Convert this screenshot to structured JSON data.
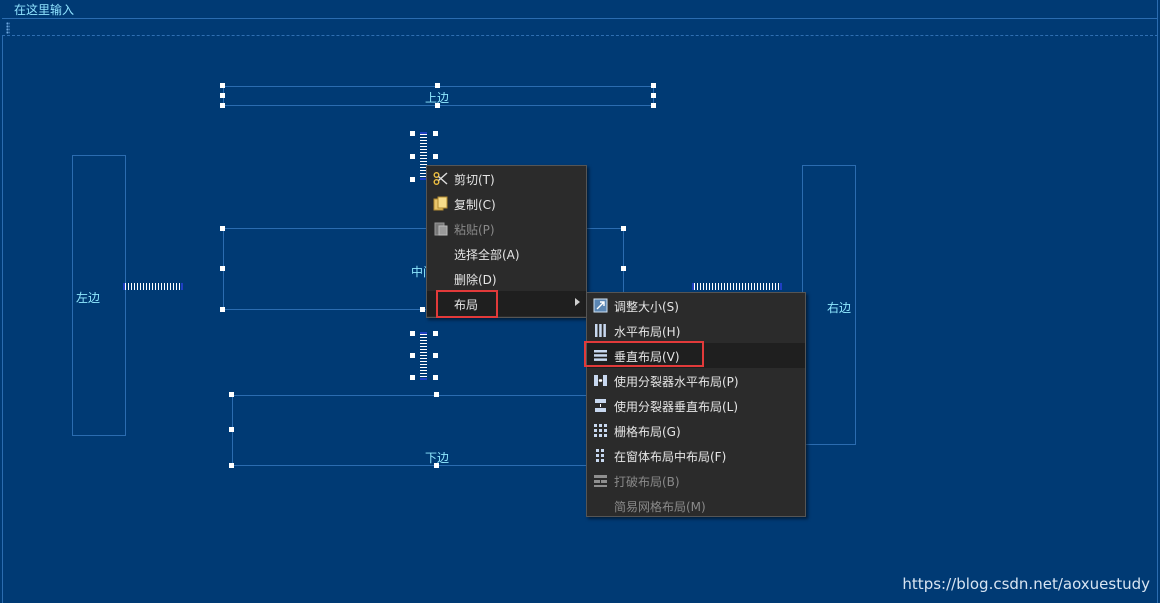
{
  "menubar": {
    "type_here": "在这里输入"
  },
  "widgets": {
    "top": "上边",
    "left": "左边",
    "center": "中间",
    "right": "右边",
    "bottom": "下边"
  },
  "context_menu": {
    "items": [
      {
        "label": "剪切(T)",
        "icon": "scissors-icon",
        "enabled": true
      },
      {
        "label": "复制(C)",
        "icon": "copy-icon",
        "enabled": true
      },
      {
        "label": "粘贴(P)",
        "icon": "paste-icon",
        "enabled": false
      },
      {
        "label": "选择全部(A)",
        "icon": "",
        "enabled": true
      },
      {
        "label": "删除(D)",
        "icon": "",
        "enabled": true
      },
      {
        "label": "布局",
        "icon": "",
        "enabled": true,
        "has_submenu": true
      }
    ]
  },
  "layout_submenu": {
    "items": [
      {
        "label": "调整大小(S)",
        "icon": "adjust-size-icon",
        "enabled": true
      },
      {
        "label": "水平布局(H)",
        "icon": "horizontal-layout-icon",
        "enabled": true
      },
      {
        "label": "垂直布局(V)",
        "icon": "vertical-layout-icon",
        "enabled": true
      },
      {
        "label": "使用分裂器水平布局(P)",
        "icon": "splitter-horizontal-icon",
        "enabled": true
      },
      {
        "label": "使用分裂器垂直布局(L)",
        "icon": "splitter-vertical-icon",
        "enabled": true
      },
      {
        "label": "栅格布局(G)",
        "icon": "grid-layout-icon",
        "enabled": true
      },
      {
        "label": "在窗体布局中布局(F)",
        "icon": "form-layout-icon",
        "enabled": true
      },
      {
        "label": "打破布局(B)",
        "icon": "break-layout-icon",
        "enabled": false
      },
      {
        "label": "简易网格布局(M)",
        "icon": "",
        "enabled": false
      }
    ]
  },
  "watermark": "https://blog.csdn.net/aoxuestudy",
  "colors": {
    "background": "#003a74",
    "menu_background": "#2b2b2b",
    "highlight": "#e23a3a",
    "label_text": "#8fe8ff"
  }
}
